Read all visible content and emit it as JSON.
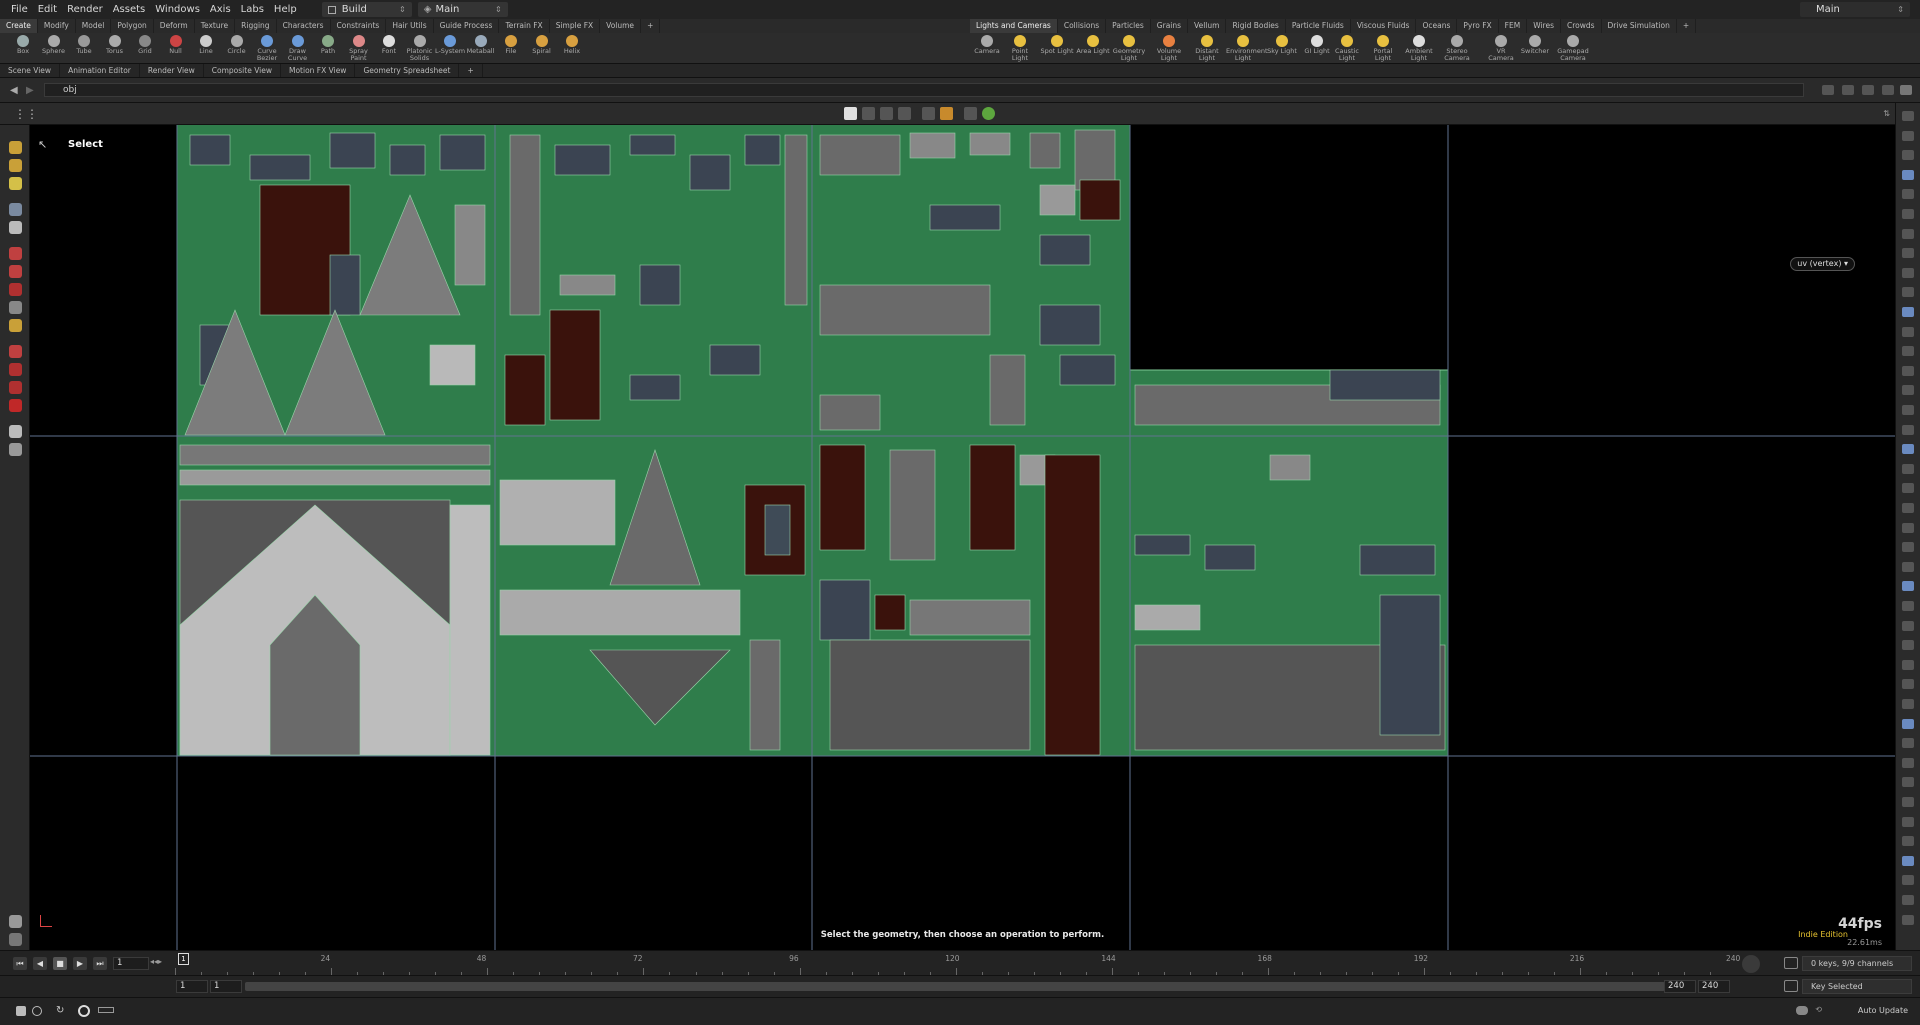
{
  "menubar": {
    "items": [
      "File",
      "Edit",
      "Render",
      "Assets",
      "Windows",
      "Axis",
      "Labs",
      "Help"
    ],
    "desktop": "Build",
    "network": "Main",
    "right_desktop": "Main"
  },
  "shelf_tabs_left": [
    "Create",
    "Modify",
    "Model",
    "Polygon",
    "Deform",
    "Texture",
    "Rigging",
    "Characters",
    "Constraints",
    "Hair Utils",
    "Guide Process",
    "Terrain FX",
    "Simple FX",
    "Volume"
  ],
  "shelf_tabs_right": [
    "Lights and Cameras",
    "Collisions",
    "Particles",
    "Grains",
    "Vellum",
    "Rigid Bodies",
    "Particle Fluids",
    "Viscous Fluids",
    "Oceans",
    "Pyro FX",
    "FEM",
    "Wires",
    "Crowds",
    "Drive Simulation"
  ],
  "tools_left": [
    "Box",
    "Sphere",
    "Tube",
    "Torus",
    "Grid",
    "Null",
    "Line",
    "Circle",
    "Curve Bezier",
    "Draw Curve",
    "Path",
    "Spray Paint",
    "Font",
    "Platonic Solids",
    "L-System",
    "Metaball",
    "File",
    "Spiral",
    "Helix"
  ],
  "tools_right": [
    "Camera",
    "Point Light",
    "Spot Light",
    "Area Light",
    "Geometry Light",
    "Volume Light",
    "Distant Light",
    "Environment Light",
    "Sky Light",
    "GI Light",
    "Caustic Light",
    "Portal Light",
    "Ambient Light",
    "Stereo Camera",
    "VR Camera",
    "Switcher",
    "Gamepad Camera"
  ],
  "pane_tabs": [
    "Scene View",
    "Animation Editor",
    "Render View",
    "Composite View",
    "Motion FX View",
    "Geometry Spreadsheet"
  ],
  "path": "obj",
  "viewport": {
    "mode_label": "Select",
    "uv_menu": "uv (vertex)",
    "status_message": "Select the geometry, then choose an operation to perform.",
    "fps": "44fps",
    "frame_ms": "22.61ms",
    "license": "Indie Edition"
  },
  "timeline": {
    "current_frame": "1",
    "tick_labels": [
      "1",
      "24",
      "48",
      "72",
      "96",
      "120",
      "144",
      "168",
      "192",
      "216",
      "240"
    ],
    "start": "1",
    "start2": "1",
    "end": "240",
    "end2": "240",
    "keys_info": "0 keys, 9/9 channels",
    "key_mode": "Key Selected",
    "update_mode": "Auto Update"
  }
}
